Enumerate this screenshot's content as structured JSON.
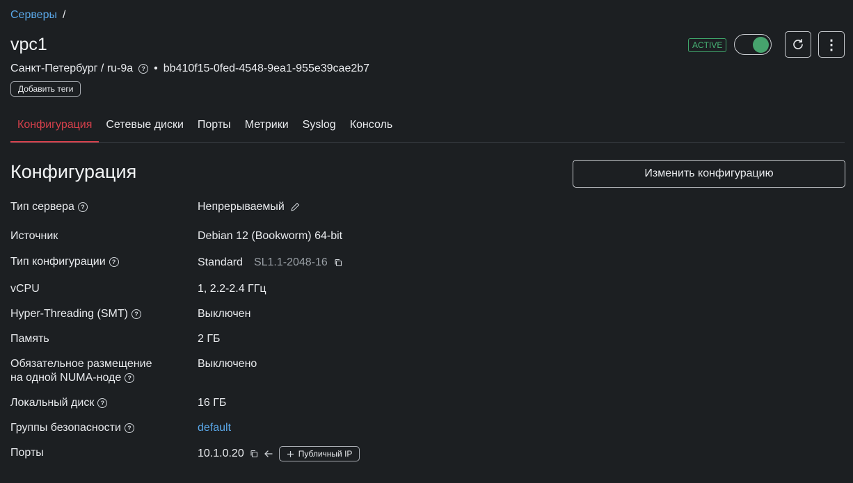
{
  "breadcrumb": {
    "root": "Серверы",
    "separator": "/"
  },
  "server": {
    "name": "vpc1",
    "location": "Санкт-Петербург / ru-9a",
    "bullet": "•",
    "id": "bb410f15-0fed-4548-9ea1-955e39cae2b7",
    "status": "ACTIVE",
    "power_on": true
  },
  "actions": {
    "add_tags": "Добавить теги",
    "help_glyph": "?",
    "more_glyph": "⋮"
  },
  "tabs": [
    {
      "label": "Конфигурация",
      "active": true
    },
    {
      "label": "Сетевые диски",
      "active": false
    },
    {
      "label": "Порты",
      "active": false
    },
    {
      "label": "Метрики",
      "active": false
    },
    {
      "label": "Syslog",
      "active": false
    },
    {
      "label": "Консоль",
      "active": false
    }
  ],
  "config": {
    "title": "Конфигурация",
    "edit_button": "Изменить конфигурацию",
    "rows": {
      "server_type": {
        "label": "Тип сервера",
        "value": "Непрерываемый"
      },
      "source": {
        "label": "Источник",
        "value": "Debian 12 (Bookworm) 64-bit"
      },
      "config_type": {
        "label": "Тип конфигурации",
        "value": "Standard",
        "code": "SL1.1-2048-16"
      },
      "vcpu": {
        "label": "vCPU",
        "value": "1, 2.2-2.4 ГГц"
      },
      "smt": {
        "label": "Hyper-Threading (SMT)",
        "value": "Выключен"
      },
      "memory": {
        "label": "Память",
        "value": "2 ГБ"
      },
      "numa": {
        "label_line1": "Обязательное размещение",
        "label_line2": "на одной NUMA-ноде",
        "value": "Выключено"
      },
      "local_disk": {
        "label": "Локальный диск",
        "value": "16 ГБ"
      },
      "security_groups": {
        "label": "Группы безопасности",
        "value": "default"
      },
      "ports": {
        "label": "Порты",
        "value": "10.1.0.20",
        "public_ip_button": "Публичный IP"
      }
    }
  },
  "colors": {
    "accent_red": "#d6404b",
    "link_blue": "#5aa7e8",
    "status_green": "#47b576",
    "background": "#1c1f22"
  }
}
